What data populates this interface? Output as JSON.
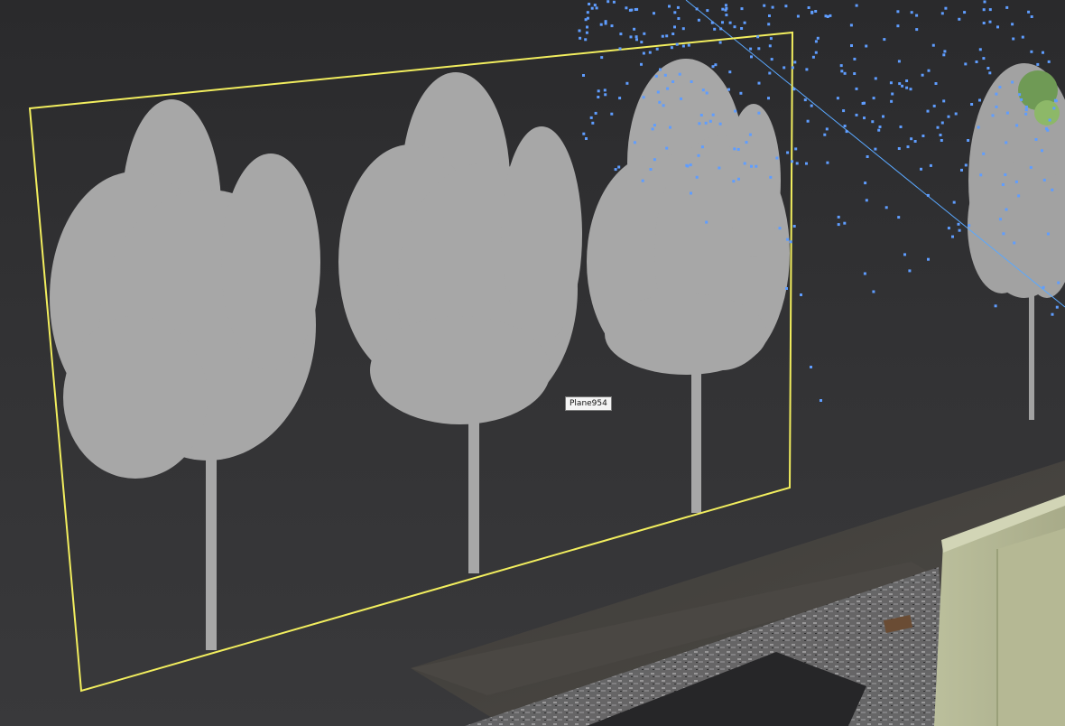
{
  "viewport": {
    "background": "#323234",
    "selection_color": "#f2ee5e",
    "particle_color": "#5f9dff",
    "tree_color": "#a7a7a7",
    "guide_line_color": "#5aa8ff"
  },
  "selected_object": {
    "name": "Plane954"
  },
  "scene_objects": [
    {
      "name": "plane-billboard",
      "icon": "tree-silhouette"
    },
    {
      "name": "particle-cloud",
      "icon": "point-cloud"
    },
    {
      "name": "road-surface",
      "icon": "asphalt"
    },
    {
      "name": "building-block",
      "icon": "box"
    }
  ]
}
